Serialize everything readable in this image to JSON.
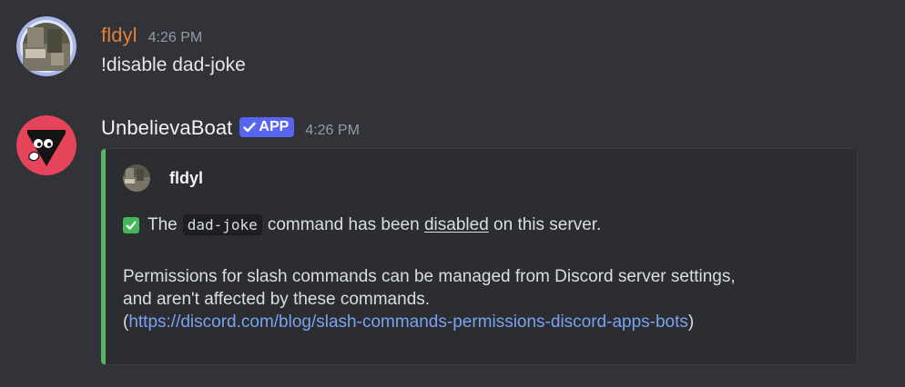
{
  "messages": [
    {
      "author": "fldyl",
      "author_color": "#e0803a",
      "timestamp": "4:26 PM",
      "content": "!disable dad-joke"
    },
    {
      "author": "UnbelievaBoat",
      "badge": "APP",
      "timestamp": "4:26 PM",
      "embed": {
        "accent_color": "#57b561",
        "author_name": "fldyl",
        "line1_prefix": "The",
        "command": "dad-joke",
        "line1_middle": "command has been",
        "line1_status": "disabled",
        "line1_suffix": "on this server.",
        "para_line1": "Permissions for slash commands can be managed from Discord server settings,",
        "para_line2": "and aren't affected by these commands.",
        "link_open": "(",
        "link_text": "https://discord.com/blog/slash-commands-permissions-discord-apps-bots",
        "link_close": ")"
      }
    }
  ]
}
